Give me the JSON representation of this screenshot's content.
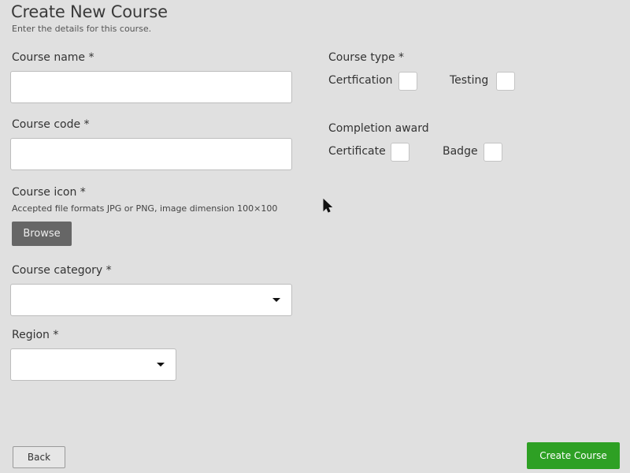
{
  "header": {
    "title": "Create New Course",
    "subtitle": "Enter the details for this course."
  },
  "form": {
    "course_name": {
      "label": "Course name *",
      "value": ""
    },
    "course_code": {
      "label": "Course code *",
      "value": ""
    },
    "course_icon": {
      "label": "Course icon *",
      "hint": "Accepted file formats JPG or PNG, image dimension 100×100",
      "browse_label": "Browse"
    },
    "course_category": {
      "label": "Course category *",
      "selected": ""
    },
    "region": {
      "label": "Region *",
      "selected": ""
    },
    "course_type": {
      "label": "Course type *",
      "options": [
        {
          "label": "Certfication",
          "checked": false
        },
        {
          "label": "Testing",
          "checked": false
        }
      ]
    },
    "completion_award": {
      "label": "Completion award",
      "options": [
        {
          "label": "Certificate",
          "checked": false
        },
        {
          "label": "Badge",
          "checked": false
        }
      ]
    }
  },
  "footer": {
    "back_label": "Back",
    "create_label": "Create Course",
    "create_color": "#2ea024"
  }
}
